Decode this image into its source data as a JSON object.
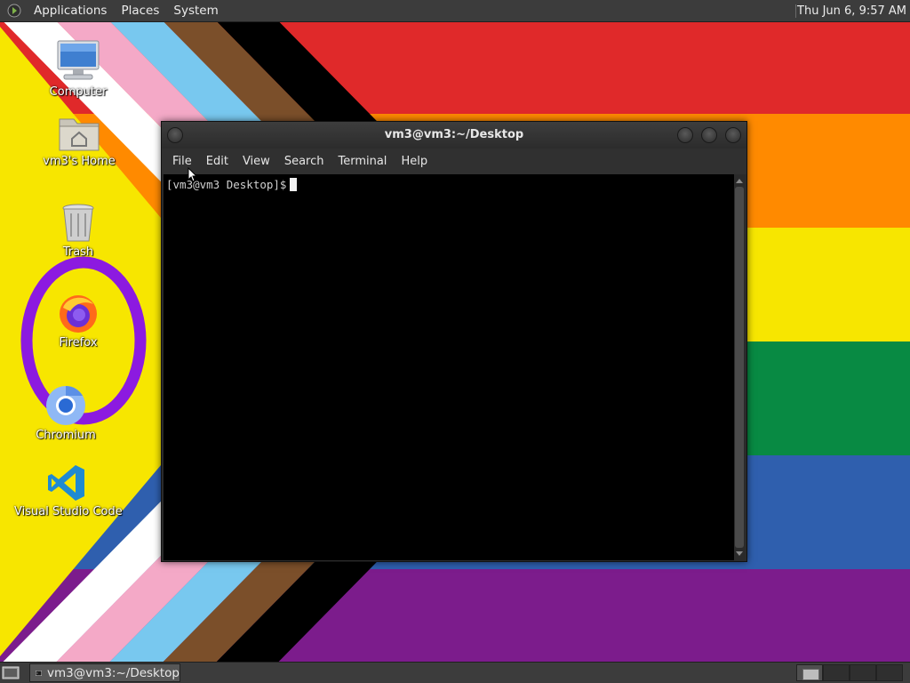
{
  "top_panel": {
    "menus": [
      "Applications",
      "Places",
      "System"
    ],
    "clock": "Thu Jun  6,  9:57 AM",
    "logo_icon": "distro-logo-icon"
  },
  "desktop_icons": [
    {
      "label": "Computer",
      "icon": "computer-icon"
    },
    {
      "label": "vm3's Home",
      "icon": "home-folder-icon"
    },
    {
      "label": "Trash",
      "icon": "trash-icon"
    },
    {
      "label": "Firefox",
      "icon": "firefox-icon"
    },
    {
      "label": "Chromium",
      "icon": "chromium-icon"
    },
    {
      "label": "Visual Studio Code",
      "icon": "vscode-icon"
    }
  ],
  "terminal": {
    "title": "vm3@vm3:~/Desktop",
    "menus": [
      "File",
      "Edit",
      "View",
      "Search",
      "Terminal",
      "Help"
    ],
    "prompt": "[vm3@vm3 Desktop]$"
  },
  "bottom_panel": {
    "task_label": "vm3@vm3:~/Desktop",
    "workspaces": 4,
    "active_workspace": 1
  },
  "colors": {
    "panel": "#3c3c3c",
    "wallpaper_red": "#e0292a",
    "wallpaper_orange": "#ff8a00",
    "wallpaper_yellow": "#f7e600",
    "wallpaper_green": "#088a43",
    "wallpaper_blue": "#2f5fae",
    "wallpaper_purple": "#7c1c8c",
    "highlight_ring": "#8c1ae0"
  }
}
